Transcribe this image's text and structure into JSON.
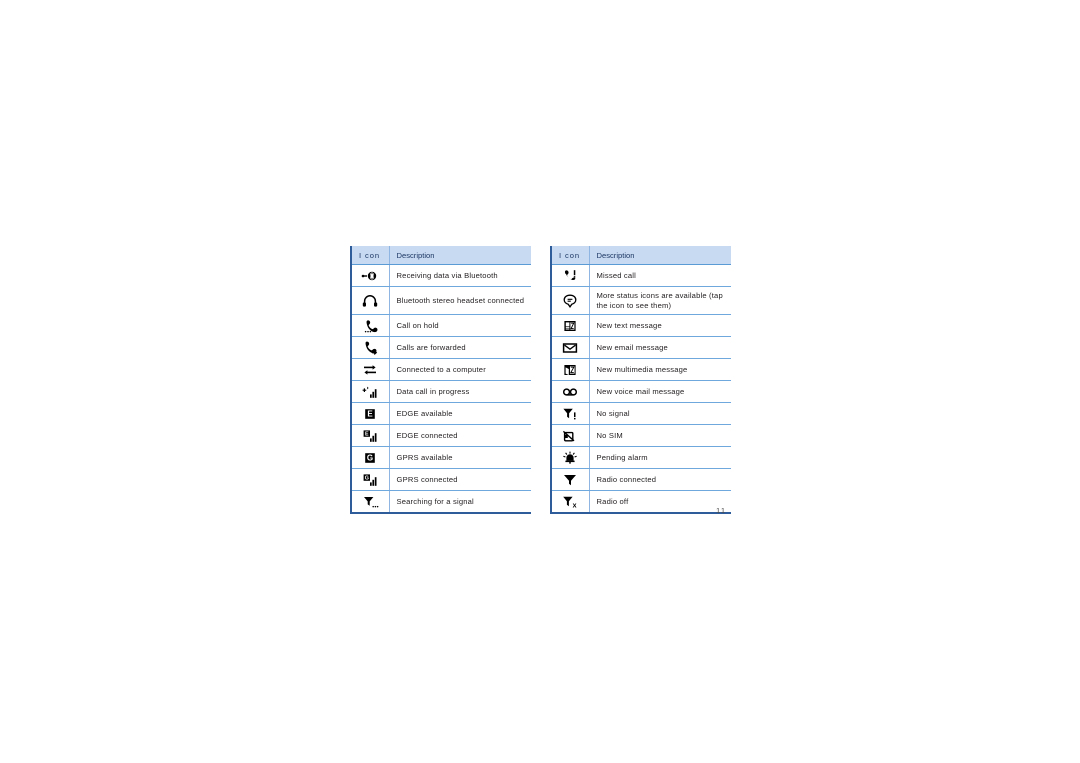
{
  "page": {
    "number": "11"
  },
  "tables": [
    {
      "id": "status-icons-table-left",
      "headers": {
        "icon": "I con",
        "description": "Description"
      },
      "rows": [
        {
          "icon_name": "receiving-data-bluetooth-icon",
          "description": "Receiving data via Bluetooth",
          "tall": false
        },
        {
          "icon_name": "bluetooth-stereo-headset-icon",
          "description": "Bluetooth stereo headset connected",
          "tall": true
        },
        {
          "icon_name": "call-on-hold-icon",
          "description": "Call on hold",
          "tall": false
        },
        {
          "icon_name": "calls-forwarded-icon",
          "description": "Calls are forwarded",
          "tall": false
        },
        {
          "icon_name": "connected-to-computer-icon",
          "description": "Connected to a computer",
          "tall": false
        },
        {
          "icon_name": "data-call-in-progress-icon",
          "description": "Data call in progress",
          "tall": false
        },
        {
          "icon_name": "edge-available-icon",
          "description": "EDGE available",
          "tall": false
        },
        {
          "icon_name": "edge-connected-icon",
          "description": "EDGE connected",
          "tall": false
        },
        {
          "icon_name": "gprs-available-icon",
          "description": "GPRS available",
          "tall": false
        },
        {
          "icon_name": "gprs-connected-icon",
          "description": "GPRS connected",
          "tall": false
        },
        {
          "icon_name": "searching-for-signal-icon",
          "description": "Searching for a signal",
          "tall": false
        }
      ]
    },
    {
      "id": "status-icons-table-right",
      "headers": {
        "icon": "I con",
        "description": "Description"
      },
      "rows": [
        {
          "icon_name": "missed-call-icon",
          "description": "Missed call",
          "tall": false
        },
        {
          "icon_name": "more-status-icons-icon",
          "description": "More status icons are available (tap the icon to see them)",
          "tall": true
        },
        {
          "icon_name": "new-text-message-icon",
          "description": "New text message",
          "tall": false
        },
        {
          "icon_name": "new-email-message-icon",
          "description": "New email message",
          "tall": false
        },
        {
          "icon_name": "new-multimedia-message-icon",
          "description": "New multimedia message",
          "tall": false
        },
        {
          "icon_name": "new-voice-mail-message-icon",
          "description": "New voice mail message",
          "tall": false
        },
        {
          "icon_name": "no-signal-icon",
          "description": "No signal",
          "tall": false
        },
        {
          "icon_name": "no-sim-icon",
          "description": "No SIM",
          "tall": false
        },
        {
          "icon_name": "pending-alarm-icon",
          "description": "Pending alarm",
          "tall": false
        },
        {
          "icon_name": "radio-connected-icon",
          "description": "Radio connected",
          "tall": false
        },
        {
          "icon_name": "radio-off-icon",
          "description": "Radio off",
          "tall": false
        }
      ]
    }
  ],
  "colors": {
    "header_bg": "#c7daf2",
    "header_text": "#1f3864",
    "rule": "#6fa8dc",
    "frame": "#2e5c9a",
    "body_text": "#231f20"
  }
}
